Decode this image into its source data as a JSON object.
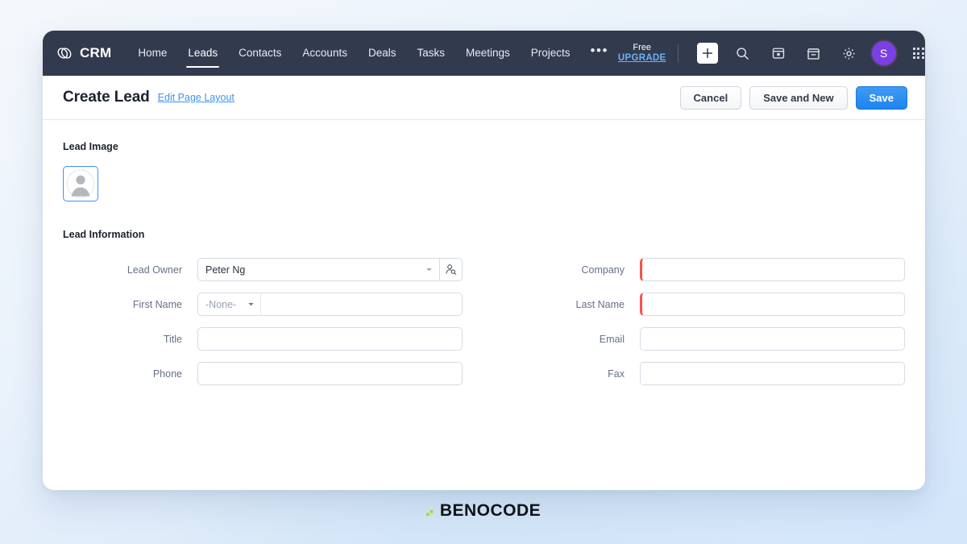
{
  "topnav": {
    "brand": {
      "label": "CRM",
      "icon": "infinity-loops-icon"
    },
    "links": [
      {
        "label": "Home",
        "active": false
      },
      {
        "label": "Leads",
        "active": true
      },
      {
        "label": "Contacts",
        "active": false
      },
      {
        "label": "Accounts",
        "active": false
      },
      {
        "label": "Deals",
        "active": false
      },
      {
        "label": "Tasks",
        "active": false
      },
      {
        "label": "Meetings",
        "active": false
      },
      {
        "label": "Projects",
        "active": false
      }
    ],
    "more_label": "•••",
    "upgrade": {
      "line1": "Free",
      "line2": "UPGRADE"
    },
    "icons": [
      "add-icon",
      "search-icon",
      "calendar-icon",
      "marketplace-icon",
      "settings-gear-icon"
    ],
    "avatar_initial": "S",
    "apps_grid_icon": "apps-grid-icon"
  },
  "page_header": {
    "title": "Create Lead",
    "edit_layout_link": "Edit Page Layout",
    "buttons": {
      "cancel": "Cancel",
      "save_and_new": "Save and New",
      "save": "Save"
    }
  },
  "lead_image": {
    "section_title": "Lead Image",
    "placeholder_icon": "person-placeholder-icon"
  },
  "lead_information": {
    "section_title": "Lead Information",
    "fields": [
      {
        "label": "Lead Owner",
        "type": "lookup",
        "value": "Peter Ng",
        "required": false,
        "lookup_icon": "person-search-icon",
        "column": "left"
      },
      {
        "label": "Company",
        "type": "text",
        "value": "",
        "placeholder": "",
        "required": true,
        "column": "right"
      },
      {
        "label": "First Name",
        "type": "split",
        "select_value": "-None-",
        "value": "",
        "placeholder": "",
        "required": false,
        "column": "left"
      },
      {
        "label": "Last Name",
        "type": "text",
        "value": "",
        "placeholder": "",
        "required": true,
        "column": "right"
      },
      {
        "label": "Title",
        "type": "text",
        "value": "",
        "placeholder": "",
        "required": false,
        "column": "left"
      },
      {
        "label": "Email",
        "type": "text",
        "value": "",
        "placeholder": "",
        "required": false,
        "column": "right"
      },
      {
        "label": "Phone",
        "type": "text",
        "value": "",
        "placeholder": "",
        "required": false,
        "column": "left"
      },
      {
        "label": "Fax",
        "type": "text",
        "value": "",
        "placeholder": "",
        "required": false,
        "column": "right"
      }
    ]
  },
  "footer": {
    "logo_text": "BENOCODE"
  },
  "colors": {
    "nav_bg": "#323a4d",
    "accent_blue": "#3e93f0",
    "primary_button": "#1d84ef",
    "required_marker": "#f8534b",
    "avatar_purple": "#7b3fe4",
    "logo_accent_green": "#9fd63a"
  }
}
